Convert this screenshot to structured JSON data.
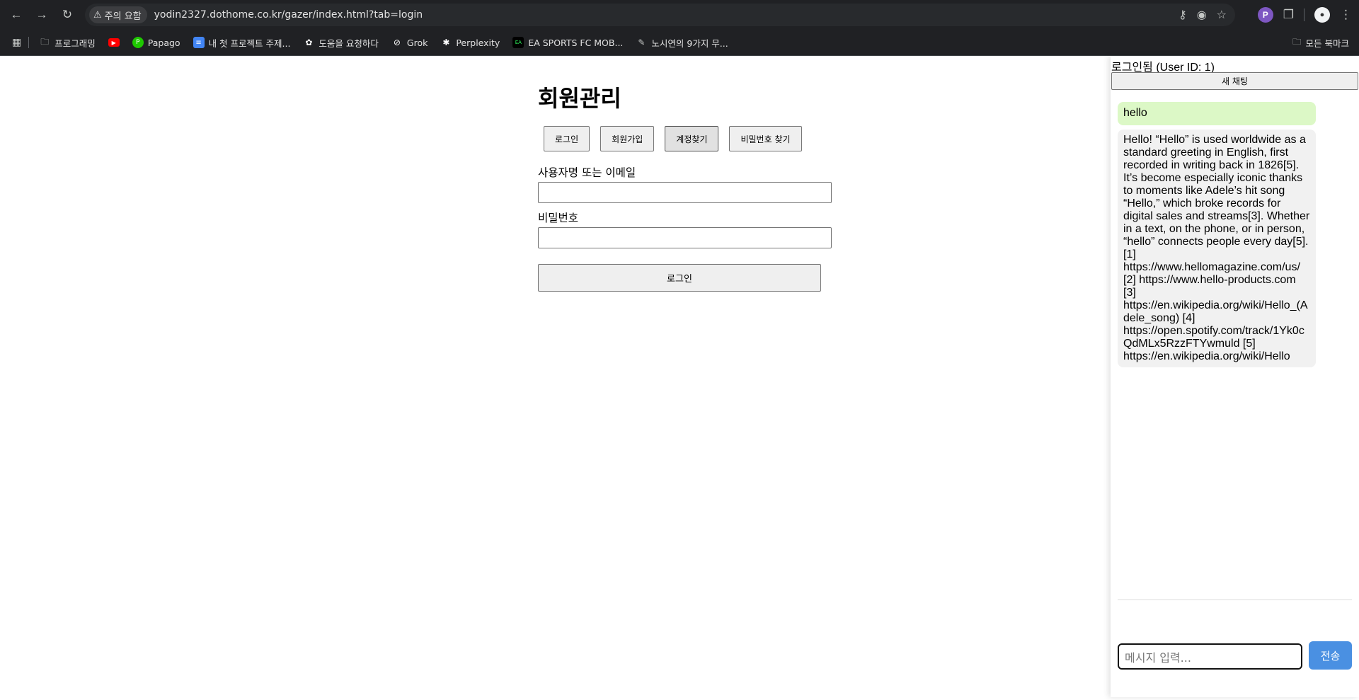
{
  "browser": {
    "security_chip": "주의 요함",
    "url": "yodin2327.dothome.co.kr/gazer/index.html?tab=login"
  },
  "bookmarks": {
    "items": [
      {
        "label": "프로그래밍",
        "icon": "folder-icon"
      },
      {
        "label": "",
        "icon": "youtube-icon"
      },
      {
        "label": "Papago",
        "icon": "papago-icon"
      },
      {
        "label": "내 첫 프로젝트 주제...",
        "icon": "docs-icon"
      },
      {
        "label": "도움을 요청하다",
        "icon": "chatgpt-icon"
      },
      {
        "label": "Grok",
        "icon": "grok-icon"
      },
      {
        "label": "Perplexity",
        "icon": "perplexity-icon"
      },
      {
        "label": "EA SPORTS FC MOB...",
        "icon": "ea-icon"
      },
      {
        "label": "노시연의 9가지 무...",
        "icon": "pen-icon"
      }
    ],
    "all_bookmarks": "모든 북마크"
  },
  "main": {
    "title": "회원관리",
    "tabs": [
      "로그인",
      "회원가입",
      "계정찾기",
      "비밀번호 찾기"
    ],
    "username_label": "사용자명 또는 이메일",
    "password_label": "비밀번호",
    "login_button": "로그인"
  },
  "chat": {
    "status": "로그인됨 (User ID: 1)",
    "new_chat": "새 채팅",
    "messages": [
      {
        "role": "user",
        "text": "hello"
      },
      {
        "role": "assistant",
        "text": "Hello! “Hello” is used worldwide as a standard greeting in English, first recorded in writing back in 1826[5]. It’s become especially iconic thanks to moments like Adele’s hit song “Hello,” which broke records for digital sales and streams[3]. Whether in a text, on the phone, or in person, “hello” connects people every day[5]. [1] https://www.hellomagazine.com/us/ [2] https://www.hello-products.com [3] https://en.wikipedia.org/wiki/Hello_(Adele_song) [4] https://open.spotify.com/track/1Yk0cQdMLx5RzzFTYwmuld [5] https://en.wikipedia.org/wiki/Hello"
      }
    ],
    "input_placeholder": "메시지 입력...",
    "send_button": "전송"
  }
}
